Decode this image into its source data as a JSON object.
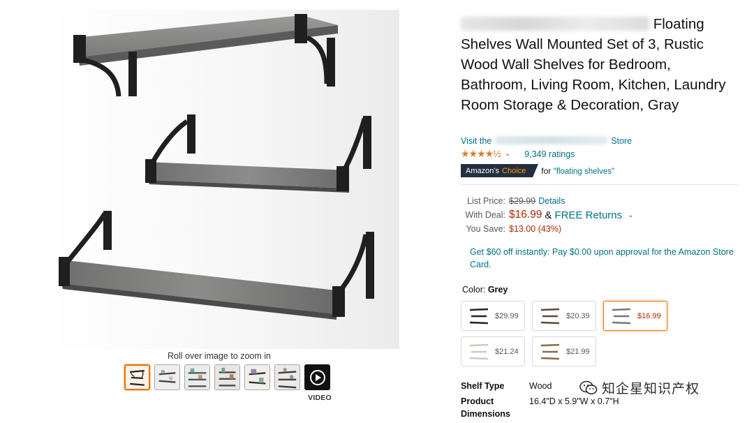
{
  "gallery": {
    "zoom_hint": "Roll over image to zoom in",
    "video_label": "VIDEO",
    "thumbnails": [
      "thumb-1",
      "thumb-2",
      "thumb-3",
      "thumb-4",
      "thumb-5",
      "thumb-6",
      "video"
    ]
  },
  "product": {
    "title_visible": "Floating Shelves Wall Mounted Set of 3, Rustic Wood Wall Shelves for Bedroom, Bathroom, Living Room, Kitchen, Laundry Room Storage & Decoration, Gray",
    "store_prefix": "Visit the",
    "store_suffix": "Store",
    "rating_stars": "★★★★½",
    "ratings_count": "9,349 ratings",
    "badge_prefix": "Amazon's",
    "badge_suffix": "Choice",
    "badge_for": "for",
    "badge_query": "\"floating shelves\""
  },
  "pricing": {
    "list_label": "List Price:",
    "list_price": "$29.99",
    "details_link": "Details",
    "deal_label": "With Deal:",
    "deal_price": "$16.99",
    "amp": "&",
    "free_returns": "FREE Returns",
    "save_label": "You Save:",
    "save_value": "$13.00 (43%)",
    "offer_text": "Get $60 off instantly: Pay $0.00 upon approval for the Amazon Store Card."
  },
  "color": {
    "label": "Color:",
    "value": "Grey",
    "options": [
      {
        "price": "$29.99",
        "selected": false
      },
      {
        "price": "$20.39",
        "selected": false
      },
      {
        "price": "$16.99",
        "selected": true
      },
      {
        "price": "$21.24",
        "selected": false
      },
      {
        "price": "$21.99",
        "selected": false
      }
    ]
  },
  "specs": [
    {
      "key": "Shelf Type",
      "value": "Wood"
    },
    {
      "key": "Product Dimensions",
      "value": "16.4\"D x 5.9\"W x 0.7\"H"
    }
  ],
  "watermark": {
    "text": "知企星知识产权"
  },
  "colors": {
    "link": "#007185",
    "price": "#b12704",
    "star": "#de7921",
    "badge_bg": "#232f3e",
    "badge_accent": "#ff9900",
    "selected_border": "#e77600"
  }
}
